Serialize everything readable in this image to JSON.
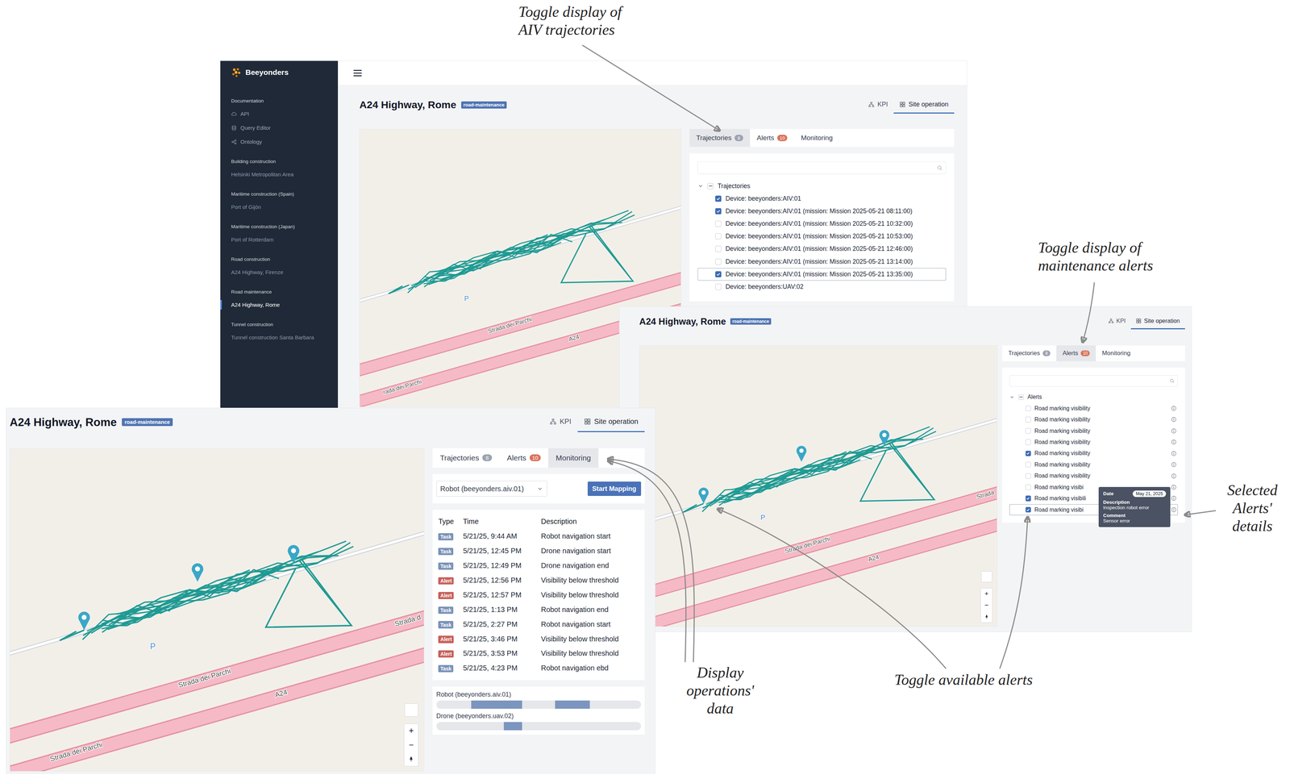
{
  "annotations": [
    {
      "lines": [
        "Toggle display of",
        "AIV trajectories"
      ]
    },
    {
      "lines": [
        "Toggle display of",
        "maintenance alerts"
      ]
    },
    {
      "lines": [
        "Selected",
        "Alerts'",
        "details"
      ]
    },
    {
      "lines": [
        "Display",
        "operations'",
        "data"
      ]
    },
    {
      "lines": [
        "Toggle available alerts"
      ]
    }
  ],
  "sidebar": {
    "brand": "Beeyonders",
    "groups": [
      {
        "title": "Documentation",
        "items": [
          {
            "label": "API",
            "selected": false
          },
          {
            "label": "Query Editor",
            "selected": false
          },
          {
            "label": "Ontology",
            "selected": false
          }
        ]
      },
      {
        "title": "Building construction",
        "items": [
          {
            "label": "Helsinki Metropolitan Area",
            "selected": false
          }
        ]
      },
      {
        "title": "Maritime construction (Spain)",
        "items": [
          {
            "label": "Port of Gijón",
            "selected": false
          }
        ]
      },
      {
        "title": "Maritime construction (Japan)",
        "items": [
          {
            "label": "Port of Rotterdam",
            "selected": false
          }
        ]
      },
      {
        "title": "Road construction",
        "items": [
          {
            "label": "A24 Highway, Firenze",
            "selected": false
          }
        ]
      },
      {
        "title": "Road maintenance",
        "items": [
          {
            "label": "A24 Highway, Rome",
            "selected": true
          }
        ]
      },
      {
        "title": "Tunnel construction",
        "items": [
          {
            "label": "Tunnel construction Santa Barbara",
            "selected": false
          }
        ]
      }
    ]
  },
  "screens": [
    {
      "title": "A24 Highway, Rome",
      "badge": "road-maintenance",
      "view_tabs": [
        {
          "label": "KPI",
          "selected": false
        },
        {
          "label": "Site operation",
          "selected": true
        }
      ],
      "panel_tabs": [
        {
          "label": "Trajectories",
          "count": "8",
          "color": "#9ca3af",
          "selected": true
        },
        {
          "label": "Alerts",
          "count": "10",
          "color": "#d9735a",
          "selected": false
        },
        {
          "label": "Monitoring",
          "selected": false
        }
      ],
      "map": {
        "labels": [
          {
            "text": "P",
            "role": "parking"
          },
          {
            "text": "Strada dei Parchi",
            "role": "upper_road"
          },
          {
            "text": "A24",
            "role": "highway"
          },
          {
            "text": "rada dei Parchi",
            "role": "lower_road"
          }
        ],
        "pins": [],
        "zoom": []
      },
      "panel": {
        "kind": "tree",
        "search": {
          "placeholder": ""
        },
        "root": {
          "label": "Trajectories",
          "expanded": true,
          "partial": true
        },
        "items": [
          {
            "label": "Device: beeyonders:AIV:01",
            "kind": "device",
            "checked": true,
            "focused": false
          },
          {
            "label": "Device: beeyonders:AIV:01 (mission: Mission 2025-05-21 08:11:00)",
            "kind": "device",
            "checked": true,
            "focused": false
          },
          {
            "label": "Device: beeyonders:AIV:01 (mission: Mission 2025-05-21 10:32:00)",
            "kind": "device",
            "checked": false,
            "focused": false
          },
          {
            "label": "Device: beeyonders:AIV:01 (mission: Mission 2025-05-21 10:53:00)",
            "kind": "device",
            "checked": false,
            "focused": false
          },
          {
            "label": "Device: beeyonders:AIV:01 (mission: Mission 2025-05-21 12:46:00)",
            "kind": "device",
            "checked": false,
            "focused": false
          },
          {
            "label": "Device: beeyonders:AIV:01 (mission: Mission 2025-05-21 13:14:00)",
            "kind": "device",
            "checked": false,
            "focused": false
          },
          {
            "label": "Device: beeyonders:AIV:01 (mission: Mission 2025-05-21 13:35:00)",
            "kind": "device",
            "checked": true,
            "focused": true
          },
          {
            "label": "Device: beeyonders:UAV:02",
            "kind": "device",
            "checked": false,
            "focused": false
          }
        ]
      }
    },
    {
      "title": "A24 Highway, Rome",
      "badge": "road-maintenance",
      "view_tabs": [
        {
          "label": "KPI",
          "selected": false
        },
        {
          "label": "Site operation",
          "selected": true
        }
      ],
      "panel_tabs": [
        {
          "label": "Trajectories",
          "count": "8",
          "color": "#9ca3af",
          "selected": false
        },
        {
          "label": "Alerts",
          "count": "10",
          "color": "#d9735a",
          "selected": true
        },
        {
          "label": "Monitoring",
          "selected": false
        }
      ],
      "map": {
        "labels": [
          {
            "text": "P",
            "role": "parking"
          },
          {
            "text": "Strada dei Parchi",
            "role": "upper_road"
          },
          {
            "text": "A24",
            "role": "highway"
          },
          {
            "text": "Strada",
            "role": "edge"
          }
        ],
        "pins": [
          {
            "kind": "alert"
          },
          {
            "kind": "alert"
          },
          {
            "kind": "alert"
          }
        ],
        "zoom": [
          "+",
          "−"
        ]
      },
      "panel": {
        "kind": "tree",
        "search": {
          "placeholder": ""
        },
        "root": {
          "label": "Alerts",
          "expanded": true,
          "partial": true
        },
        "items": [
          {
            "label": "Road marking visibility",
            "kind": "alert",
            "checked": false,
            "focused": false
          },
          {
            "label": "Road marking visibility",
            "kind": "alert",
            "checked": false,
            "focused": false
          },
          {
            "label": "Road marking visibility",
            "kind": "alert",
            "checked": false,
            "focused": false
          },
          {
            "label": "Road marking visibility",
            "kind": "alert",
            "checked": false,
            "focused": false
          },
          {
            "label": "Road marking visibility",
            "kind": "alert",
            "checked": true,
            "focused": false
          },
          {
            "label": "Road marking visibility",
            "kind": "alert",
            "checked": false,
            "focused": false
          },
          {
            "label": "Road marking visibility",
            "kind": "alert",
            "checked": false,
            "focused": false
          },
          {
            "label": "Road marking visibi",
            "kind": "alert",
            "checked": false,
            "focused": false
          },
          {
            "label": "Road marking visibili",
            "kind": "alert",
            "checked": true,
            "focused": false
          },
          {
            "label": "Road marking visibi",
            "kind": "alert",
            "checked": true,
            "focused": true,
            "details": {
              "date_label": "Date",
              "date": "May 21, 2025",
              "fields": [
                {
                  "label": "Description",
                  "value": "Inspection robot error"
                },
                {
                  "label": "Comment",
                  "value": "Sensor error"
                }
              ]
            }
          }
        ]
      }
    },
    {
      "title": "A24 Highway, Rome",
      "badge": "road-maintenance",
      "view_tabs": [
        {
          "label": "KPI",
          "selected": false
        },
        {
          "label": "Site operation",
          "selected": true
        }
      ],
      "panel_tabs": [
        {
          "label": "Trajectories",
          "count": "8",
          "color": "#9ca3af",
          "selected": false
        },
        {
          "label": "Alerts",
          "count": "10",
          "color": "#d9735a",
          "selected": false
        },
        {
          "label": "Monitoring",
          "selected": true
        }
      ],
      "map": {
        "labels": [
          {
            "text": "P",
            "role": "parking"
          },
          {
            "text": "Strada d",
            "role": "edge"
          },
          {
            "text": "Strada dei Parchi",
            "role": "upper_road"
          },
          {
            "text": "A24",
            "role": "highway"
          },
          {
            "text": "Strada dei Parchi",
            "role": "lower_road"
          }
        ],
        "pins": [
          {
            "kind": "alert"
          },
          {
            "kind": "alert"
          },
          {
            "kind": "alert"
          }
        ],
        "zoom": [
          "+",
          "−"
        ]
      },
      "panel": {
        "kind": "monitoring",
        "select": {
          "value": "Robot (beeyonders.aiv.01)"
        },
        "button": "Start Mapping",
        "table": {
          "columns": [
            "Type",
            "Time",
            "Description"
          ],
          "rows": [
            {
              "type": "Task",
              "color": "#7a92b8",
              "time": "5/21/25, 9:44 AM",
              "description": "Robot navigation start"
            },
            {
              "type": "Task",
              "color": "#7a92b8",
              "time": "5/21/25, 12:45 PM",
              "description": "Drone navigation start"
            },
            {
              "type": "Task",
              "color": "#7a92b8",
              "time": "5/21/25, 12:49 PM",
              "description": "Drone navigation end"
            },
            {
              "type": "Alert",
              "color": "#c7615c",
              "time": "5/21/25, 12:56 PM",
              "description": "Visibility below threshold"
            },
            {
              "type": "Alert",
              "color": "#c7615c",
              "time": "5/21/25, 12:57 PM",
              "description": "Visibility below threshold"
            },
            {
              "type": "Task",
              "color": "#7a92b8",
              "time": "5/21/25, 1:13 PM",
              "description": "Robot navigation end"
            },
            {
              "type": "Task",
              "color": "#7a92b8",
              "time": "5/21/25, 2:27 PM",
              "description": "Robot navigation start"
            },
            {
              "type": "Alert",
              "color": "#c7615c",
              "time": "5/21/25, 3:46 PM",
              "description": "Visibility below threshold"
            },
            {
              "type": "Alert",
              "color": "#c7615c",
              "time": "5/21/25, 3:53 PM",
              "description": "Visibility below threshold"
            },
            {
              "type": "Task",
              "color": "#7a92b8",
              "time": "5/21/25, 4:23 PM",
              "description": "Robot navigation ebd"
            }
          ]
        },
        "timeline": [
          {
            "label": "Robot (beeyonders.aiv.01)",
            "segments": [
              {
                "start": 0.17,
                "end": 0.42
              },
              {
                "start": 0.58,
                "end": 0.75
              }
            ]
          },
          {
            "label": "Drone (beeyonders.uav.02)",
            "segments": [
              {
                "start": 0.33,
                "end": 0.42
              }
            ]
          }
        ]
      }
    }
  ]
}
